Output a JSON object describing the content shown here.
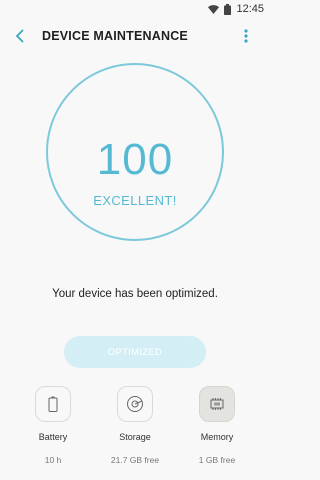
{
  "status_bar": {
    "time": "12:45",
    "icons": [
      "wifi-icon",
      "battery-icon"
    ]
  },
  "app_bar": {
    "title": "DEVICE MAINTENANCE",
    "back_icon": "chevron-left-icon",
    "menu_icon": "more-vert-icon"
  },
  "score": {
    "value": "100",
    "rating": "EXCELLENT!"
  },
  "message": "Your device has been optimized.",
  "optimize_button": {
    "label": "OPTIMIZED"
  },
  "tiles": [
    {
      "label": "Battery",
      "value": "10 h",
      "icon": "battery-icon"
    },
    {
      "label": "Storage",
      "value": "21.7 GB free",
      "icon": "storage-icon"
    },
    {
      "label": "Memory",
      "value": "1 GB free",
      "icon": "memory-chip-icon"
    }
  ],
  "colors": {
    "accent": "#55b9d3",
    "ring": "#7cc9dc",
    "button_bg": "#d4eef5"
  }
}
